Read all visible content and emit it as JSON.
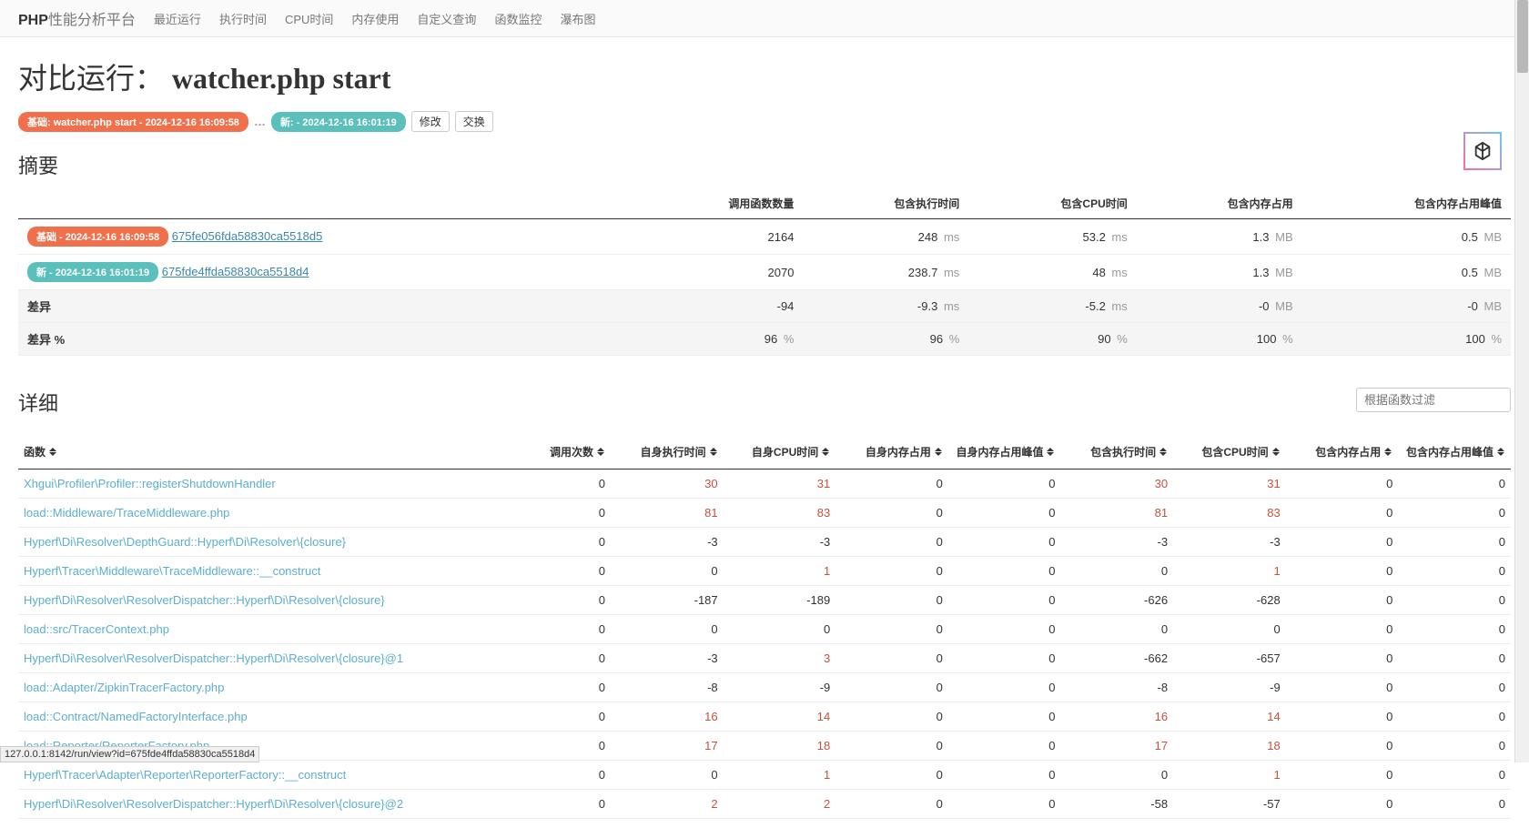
{
  "nav": {
    "brand_bold": "PHP",
    "brand_rest": "性能分析平台",
    "items": [
      "最近运行",
      "执行时间",
      "CPU时间",
      "内存使用",
      "自定义查询",
      "函数监控",
      "瀑布图"
    ]
  },
  "title": {
    "prefix": "对比运行：",
    "name": "watcher.php start"
  },
  "badges": {
    "base": "基础: watcher.php start - 2024-12-16 16:09:58",
    "ellipsis": "…",
    "new": "新: - 2024-12-16 16:01:19",
    "btn_modify": "修改",
    "btn_swap": "交换"
  },
  "summary": {
    "heading": "摘要",
    "headers": [
      "",
      "调用函数数量",
      "包含执行时间",
      "包含CPU时间",
      "包含内存占用",
      "包含内存占用峰值"
    ],
    "rows": [
      {
        "badge": "基础 - 2024-12-16 16:09:58",
        "badge_class": "orange",
        "link": "675fe056fda58830ca5518d5",
        "cells": [
          {
            "v": "2164"
          },
          {
            "v": "248",
            "u": "ms"
          },
          {
            "v": "53.2",
            "u": "ms"
          },
          {
            "v": "1.3",
            "u": "MB"
          },
          {
            "v": "0.5",
            "u": "MB"
          }
        ]
      },
      {
        "badge": "新 - 2024-12-16 16:01:19",
        "badge_class": "teal",
        "link": "675fde4ffda58830ca5518d4",
        "cells": [
          {
            "v": "2070"
          },
          {
            "v": "238.7",
            "u": "ms"
          },
          {
            "v": "48",
            "u": "ms"
          },
          {
            "v": "1.3",
            "u": "MB"
          },
          {
            "v": "0.5",
            "u": "MB"
          }
        ]
      },
      {
        "label": "差异",
        "cells": [
          {
            "v": "-94"
          },
          {
            "v": "-9.3",
            "u": "ms"
          },
          {
            "v": "-5.2",
            "u": "ms"
          },
          {
            "v": "-0",
            "u": "MB"
          },
          {
            "v": "-0",
            "u": "MB"
          }
        ]
      },
      {
        "label": "差异 %",
        "cells": [
          {
            "v": "96",
            "u": "%"
          },
          {
            "v": "96",
            "u": "%"
          },
          {
            "v": "90",
            "u": "%"
          },
          {
            "v": "100",
            "u": "%"
          },
          {
            "v": "100",
            "u": "%"
          }
        ]
      }
    ]
  },
  "detail": {
    "heading": "详细",
    "filter_placeholder": "根据函数过滤",
    "headers": [
      "函数",
      "调用次数",
      "自身执行时间",
      "自身CPU时间",
      "自身内存占用",
      "自身内存占用峰值",
      "包含执行时间",
      "包含CPU时间",
      "包含内存占用",
      "包含内存占用峰值"
    ],
    "rows": [
      {
        "fn": "Xhgui\\Profiler\\Profiler::registerShutdownHandler",
        "v": [
          "0",
          "30",
          "31",
          "0",
          "0",
          "30",
          "31",
          "0",
          "0"
        ]
      },
      {
        "fn": "load::Middleware/TraceMiddleware.php",
        "v": [
          "0",
          "81",
          "83",
          "0",
          "0",
          "81",
          "83",
          "0",
          "0"
        ]
      },
      {
        "fn": "Hyperf\\Di\\Resolver\\DepthGuard::Hyperf\\Di\\Resolver\\{closure}",
        "v": [
          "0",
          "-3",
          "-3",
          "0",
          "0",
          "-3",
          "-3",
          "0",
          "0"
        ]
      },
      {
        "fn": "Hyperf\\Tracer\\Middleware\\TraceMiddleware::__construct",
        "v": [
          "0",
          "0",
          "1",
          "0",
          "0",
          "0",
          "1",
          "0",
          "0"
        ]
      },
      {
        "fn": "Hyperf\\Di\\Resolver\\ResolverDispatcher::Hyperf\\Di\\Resolver\\{closure}",
        "v": [
          "0",
          "-187",
          "-189",
          "0",
          "0",
          "-626",
          "-628",
          "0",
          "0"
        ]
      },
      {
        "fn": "load::src/TracerContext.php",
        "v": [
          "0",
          "0",
          "0",
          "0",
          "0",
          "0",
          "0",
          "0",
          "0"
        ]
      },
      {
        "fn": "Hyperf\\Di\\Resolver\\ResolverDispatcher::Hyperf\\Di\\Resolver\\{closure}@1",
        "v": [
          "0",
          "-3",
          "3",
          "0",
          "0",
          "-662",
          "-657",
          "0",
          "0"
        ]
      },
      {
        "fn": "load::Adapter/ZipkinTracerFactory.php",
        "v": [
          "0",
          "-8",
          "-9",
          "0",
          "0",
          "-8",
          "-9",
          "0",
          "0"
        ]
      },
      {
        "fn": "load::Contract/NamedFactoryInterface.php",
        "v": [
          "0",
          "16",
          "14",
          "0",
          "0",
          "16",
          "14",
          "0",
          "0"
        ]
      },
      {
        "fn": "load::Reporter/ReporterFactory.php",
        "v": [
          "0",
          "17",
          "18",
          "0",
          "0",
          "17",
          "18",
          "0",
          "0"
        ]
      },
      {
        "fn": "Hyperf\\Tracer\\Adapter\\Reporter\\ReporterFactory::__construct",
        "v": [
          "0",
          "0",
          "1",
          "0",
          "0",
          "0",
          "1",
          "0",
          "0"
        ]
      },
      {
        "fn": "Hyperf\\Di\\Resolver\\ResolverDispatcher::Hyperf\\Di\\Resolver\\{closure}@2",
        "v": [
          "0",
          "2",
          "2",
          "0",
          "0",
          "-58",
          "-57",
          "0",
          "0"
        ]
      }
    ],
    "positive_cols": [
      1,
      2,
      5,
      6
    ]
  },
  "status": "127.0.0.1:8142/run/view?id=675fde4ffda58830ca5518d4"
}
